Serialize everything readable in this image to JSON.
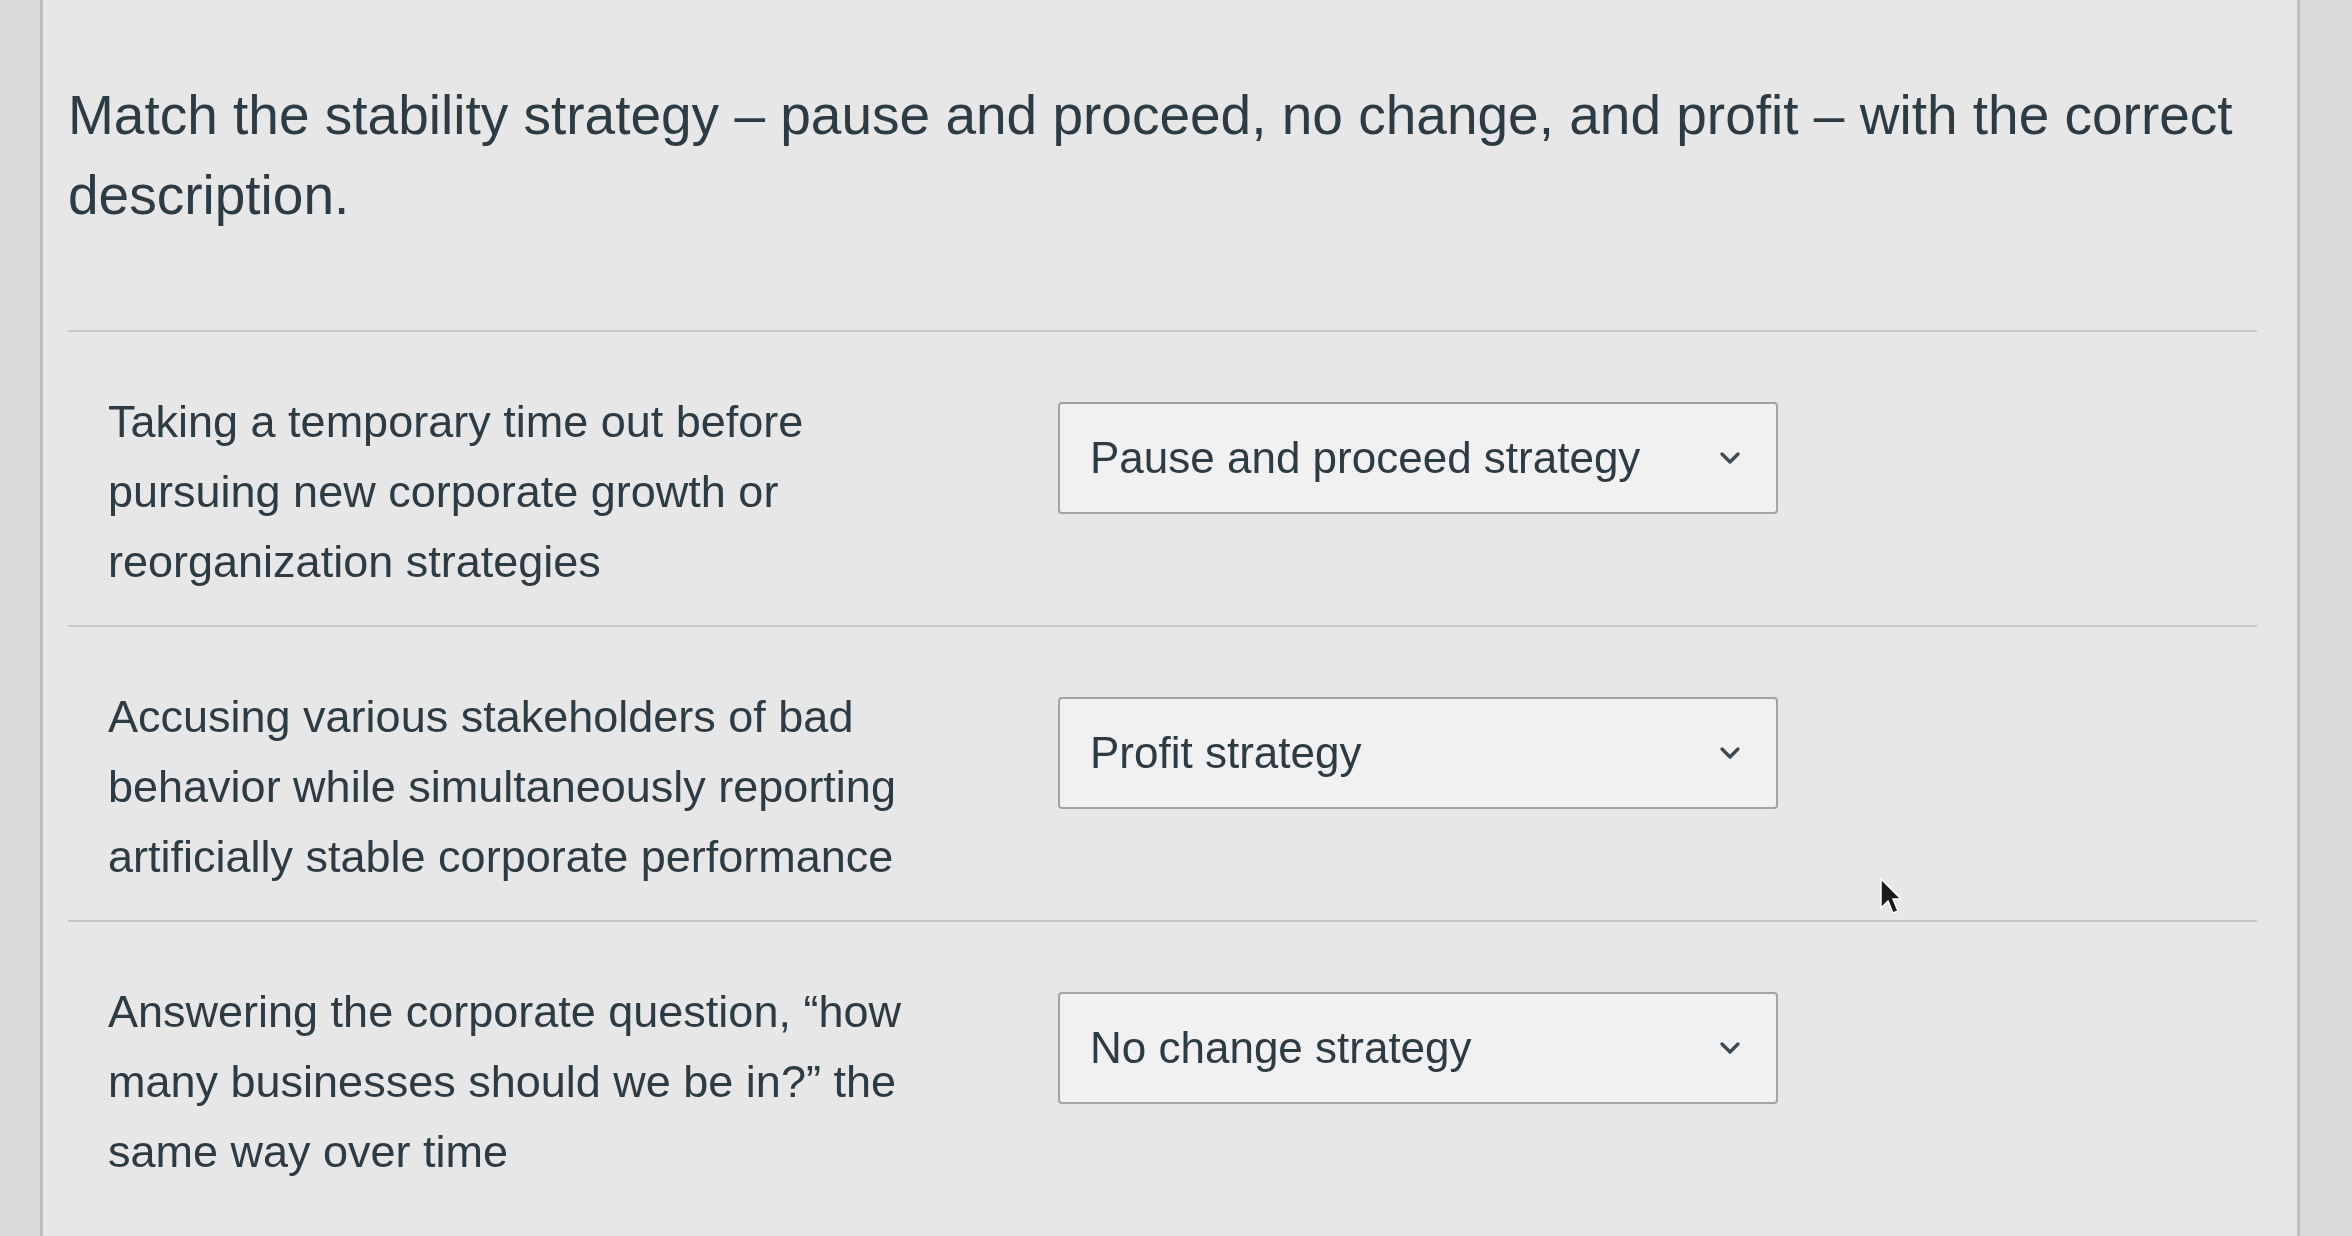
{
  "question": {
    "text": "Match the stability strategy – pause and proceed, no change, and profit – with the correct description."
  },
  "items": [
    {
      "description": "Taking a temporary time out before pursuing new corporate growth or reorganization strategies",
      "answer": "Pause and proceed strategy"
    },
    {
      "description": "Accusing various stakeholders of bad behavior while simultaneously reporting artificially stable corporate performance",
      "answer": "Profit strategy"
    },
    {
      "description": "Answering the corporate question, “how many businesses should we be in?” the same way over time",
      "answer": "No change strategy"
    }
  ]
}
